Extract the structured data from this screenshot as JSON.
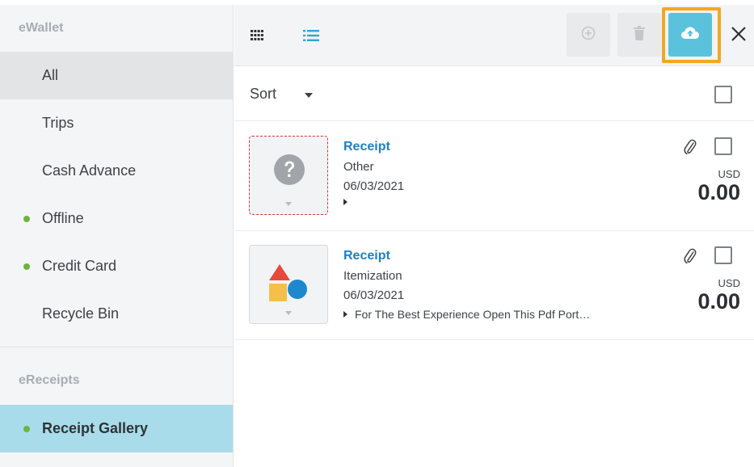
{
  "sidebar": {
    "ewallet_heading": "eWallet",
    "items": [
      {
        "label": "All",
        "dot": false
      },
      {
        "label": "Trips",
        "dot": false
      },
      {
        "label": "Cash Advance",
        "dot": false
      },
      {
        "label": "Offline",
        "dot": true
      },
      {
        "label": "Credit Card",
        "dot": true
      },
      {
        "label": "Recycle Bin",
        "dot": false
      }
    ],
    "ereceipts_heading": "eReceipts",
    "gallery_label": "Receipt Gallery"
  },
  "toolbar": {
    "icons": {
      "grid_view": "grid-view-icon",
      "list_view": "list-view-icon",
      "add": "plus-circle-icon",
      "delete": "trash-icon",
      "upload": "cloud-upload-icon",
      "close": "close-icon"
    },
    "colors": {
      "upload_button": "#5bc2de",
      "highlight": "#f3a820",
      "list_view_active": "#2ba6d9"
    }
  },
  "sort": {
    "label": "Sort"
  },
  "receipts": [
    {
      "title": "Receipt",
      "type": "Other",
      "date": "06/03/2021",
      "note": "",
      "currency": "USD",
      "amount": "0.00",
      "thumbnail": "question-mark-icon"
    },
    {
      "title": "Receipt",
      "type": "Itemization",
      "date": "06/03/2021",
      "note": "For The Best Experience Open This Pdf Port…",
      "currency": "USD",
      "amount": "0.00",
      "thumbnail": "shapes-icon"
    }
  ]
}
